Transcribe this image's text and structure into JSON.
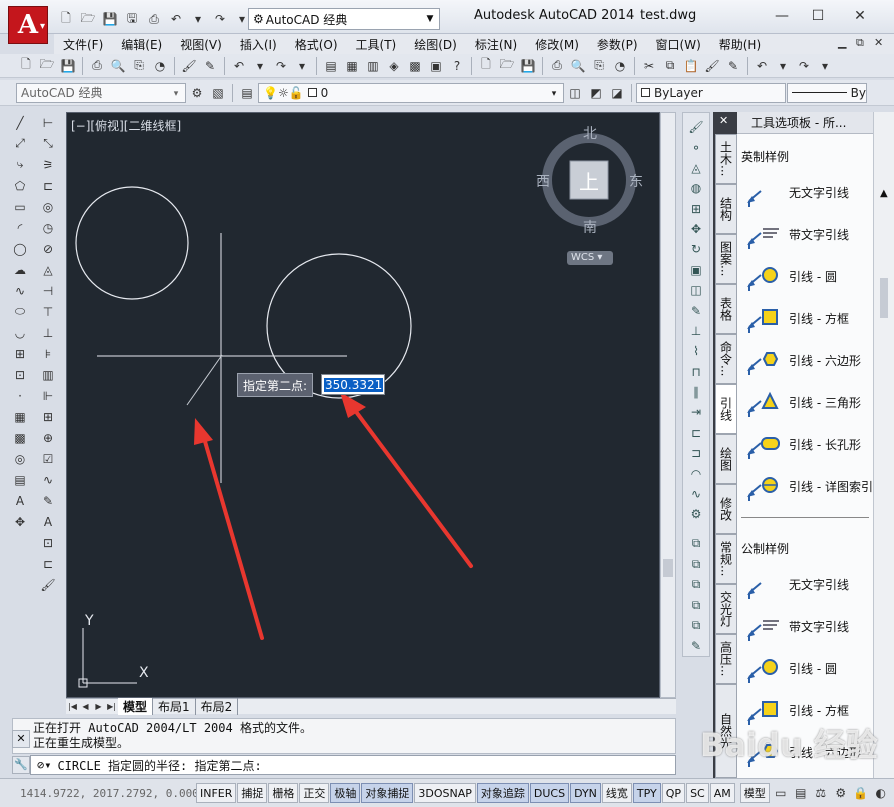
{
  "title_bar": {
    "app_title": "Autodesk AutoCAD 2014",
    "file_name": "test.dwg",
    "workspace_combo": "AutoCAD 经典",
    "app_logo": "A",
    "window_controls": [
      "—",
      "☐",
      "✕"
    ]
  },
  "menu": {
    "items": [
      "文件(F)",
      "编辑(E)",
      "视图(V)",
      "插入(I)",
      "格式(O)",
      "工具(T)",
      "绘图(D)",
      "标注(N)",
      "修改(M)",
      "参数(P)",
      "窗口(W)",
      "帮助(H)"
    ],
    "right_controls": [
      "▁",
      "⧉",
      "✕"
    ]
  },
  "toolbar2": {
    "workspace": "AutoCAD 经典",
    "layer": "0",
    "color": "ByLayer",
    "linetype_tail": "By"
  },
  "viewport": {
    "label": "[−][俯视][二维线框]",
    "viewcube": {
      "north": "北",
      "south": "南",
      "west": "西",
      "east": "东",
      "top": "上",
      "wcs": "WCS"
    },
    "ucs": {
      "x": "X",
      "y": "Y"
    },
    "prompt_label": "指定第二点:",
    "input_value": "350.3321"
  },
  "layout_tabs": [
    "模型",
    "布局1",
    "布局2"
  ],
  "command": {
    "history": [
      "正在打开 AutoCAD 2004/LT 2004 格式的文件。",
      "正在重生成模型。"
    ],
    "current": "CIRCLE 指定圆的半径: 指定第二点:"
  },
  "status": {
    "coords": "1414.9722, 2017.2792, 0.0000",
    "buttons": [
      "INFER",
      "捕捉",
      "栅格",
      "正交",
      "极轴",
      "对象捕捉",
      "3DOSNAP",
      "对象追踪",
      "DUCS",
      "DYN",
      "线宽",
      "TPY",
      "QP",
      "SC",
      "AM"
    ],
    "active_buttons": [
      "极轴",
      "对象捕捉",
      "对象追踪",
      "DUCS",
      "DYN",
      "TPY"
    ],
    "model": "模型"
  },
  "tool_palette": {
    "title": "工具选项板 - 所...",
    "tabs": [
      "土木...",
      "结构",
      "图案...",
      "表格",
      "命令...",
      "引线",
      "绘图",
      "修改",
      "常规...",
      "交光灯",
      "高压...",
      "自然光"
    ],
    "active_tab": "引线",
    "sections": [
      {
        "name": "英制样例",
        "items": [
          "无文字引线",
          "带文字引线",
          "引线 - 圆",
          "引线 - 方框",
          "引线 - 六边形",
          "引线 - 三角形",
          "引线 - 长孔形",
          "引线 - 详图索引"
        ]
      },
      {
        "name": "公制样例",
        "items": [
          "无文字引线",
          "带文字引线",
          "引线 - 圆",
          "引线 - 方框",
          "引线 - 六边形"
        ]
      }
    ]
  },
  "watermark": "Baidu 经验",
  "colors": {
    "canvas": "#212830",
    "accent_red": "#e8372f",
    "input_highlight": "#0a5fc4"
  }
}
